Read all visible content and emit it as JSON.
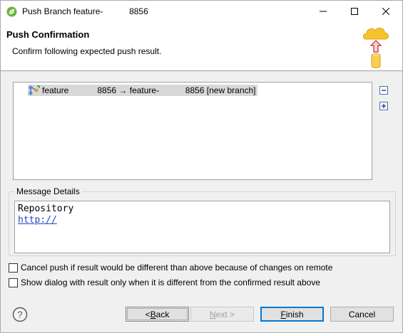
{
  "window": {
    "title": "Push Branch feature-           8856"
  },
  "header": {
    "title": "Push Confirmation",
    "subtitle": "Confirm following expected push result."
  },
  "tree": {
    "row": {
      "source": "feature            8856",
      "arrow": " → ",
      "target": "feature-           8856",
      "tag": " [new branch]"
    }
  },
  "message_details": {
    "label": "Message Details",
    "line1": "Repository",
    "link": "http://"
  },
  "options": [
    {
      "label": "Cancel push if result would be different than above because of changes on remote",
      "checked": false
    },
    {
      "label": "Show dialog with result only when it is different from the confirmed result above",
      "checked": false
    }
  ],
  "buttons": {
    "back": {
      "prefix": "< ",
      "mnemonic": "B",
      "rest": "ack"
    },
    "next": {
      "mnemonic": "N",
      "rest": "ext >"
    },
    "finish": {
      "mnemonic": "F",
      "rest": "inish"
    },
    "cancel": "Cancel"
  },
  "colors": {
    "accent": "#0078d7",
    "link": "#2a44c8",
    "selection": "#d8d8d8"
  }
}
